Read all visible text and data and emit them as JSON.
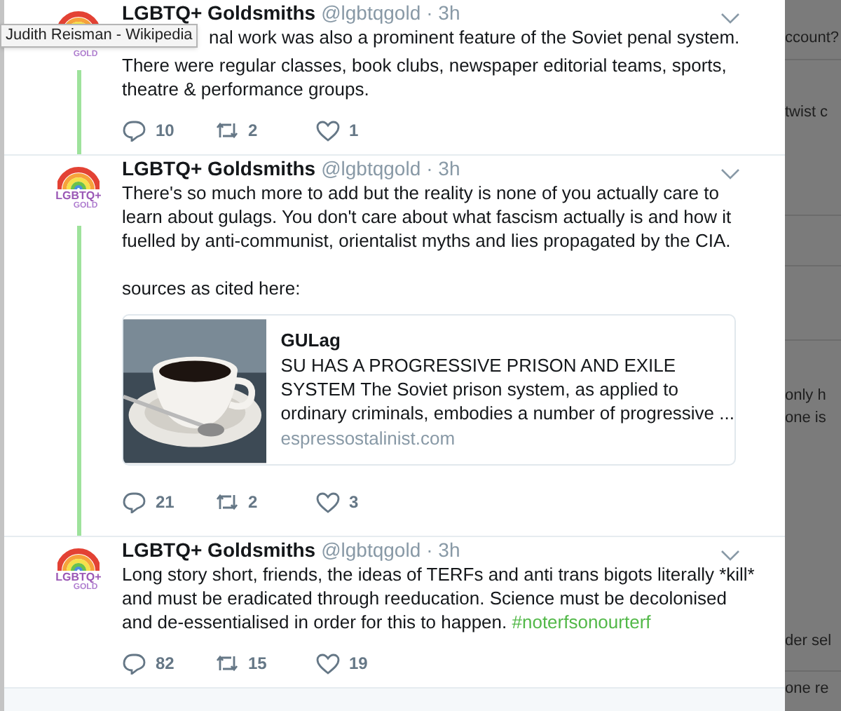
{
  "tooltip": {
    "text": "Judith Reisman - Wikipedia"
  },
  "tweets": [
    {
      "name": "LGBTQ+ Goldsmiths",
      "handle": "@lgbtqgold",
      "time": "· 3h",
      "avatar_text": [
        "GOLD"
      ],
      "covered_by_tooltip": true,
      "paragraphs": [
        [
          "nal work was also a prominent feature of the Soviet penal system."
        ],
        [
          "There were regular classes, book clubs, newspaper editorial teams, sports,",
          "theatre & performance groups."
        ]
      ],
      "replies": "10",
      "retweets": "2",
      "likes": "1",
      "thread_below": true
    },
    {
      "name": "LGBTQ+ Goldsmiths",
      "handle": "@lgbtqgold",
      "time": "· 3h",
      "avatar_text": [
        "LGBTQ+",
        "GOLD"
      ],
      "covered_by_tooltip": false,
      "paragraphs": [
        [
          "There's so much more to add but the reality is none of you actually care to",
          "learn about gulags. You don't care about what fascism actually is and how it",
          "fuelled by anti-communist, orientalist myths and lies propagated by the CIA."
        ],
        [
          "sources as cited here:"
        ]
      ],
      "card": {
        "kind": "picture",
        "title": "GULag",
        "description": [
          "SU HAS A PROGRESSIVE PRISON AND EXILE",
          "SYSTEM The Soviet prison system, as applied to",
          "ordinary criminals, embodies a number of progressive ..."
        ],
        "domain": "espressostalinist.com"
      },
      "replies": "21",
      "retweets": "2",
      "likes": "3",
      "thread_below": true
    },
    {
      "name": "LGBTQ+ Goldsmiths",
      "handle": "@lgbtqgold",
      "time": "· 3h",
      "avatar_text": [
        "LGBTQ+",
        "GOLD"
      ],
      "covered_by_tooltip": false,
      "paragraphs": [
        [
          "Long story short, friends, the ideas of TERFs and anti trans bigots literally *kill*",
          "and must be eradicated through reeducation.  Science must be decolonised",
          "and de-essentialised in order for this to happen."
        ]
      ],
      "hashtag": "#noterfsonourterf",
      "replies": "82",
      "retweets": "15",
      "likes": "19",
      "thread_below": false
    }
  ],
  "background_texts": [
    "ccount?",
    "twist c",
    "only h",
    "one is",
    "der sel",
    "one re"
  ]
}
